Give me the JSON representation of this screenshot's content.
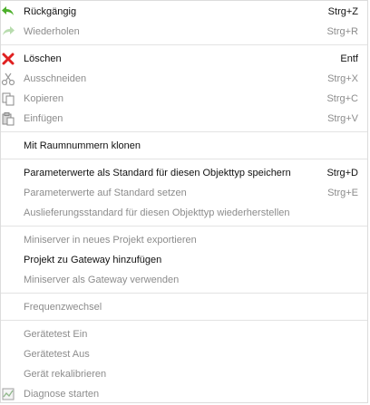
{
  "menu": {
    "items": [
      {
        "label": "Rückgängig",
        "shortcut": "Strg+Z",
        "icon": "undo-arrow-icon",
        "enabled": true
      },
      {
        "label": "Wiederholen",
        "shortcut": "Strg+R",
        "icon": "redo-arrow-icon",
        "enabled": false
      },
      {
        "label": "Löschen",
        "shortcut": "Entf",
        "icon": "delete-x-icon",
        "enabled": true
      },
      {
        "label": "Ausschneiden",
        "shortcut": "Strg+X",
        "icon": "scissors-icon",
        "enabled": false
      },
      {
        "label": "Kopieren",
        "shortcut": "Strg+C",
        "icon": "copy-icon",
        "enabled": false
      },
      {
        "label": "Einfügen",
        "shortcut": "Strg+V",
        "icon": "paste-icon",
        "enabled": false
      },
      {
        "label": "Mit Raumnummern klonen",
        "shortcut": "",
        "enabled": true
      },
      {
        "label": "Parameterwerte als Standard für diesen Objekttyp speichern",
        "shortcut": "Strg+D",
        "enabled": true
      },
      {
        "label": "Parameterwerte auf Standard setzen",
        "shortcut": "Strg+E",
        "enabled": false
      },
      {
        "label": "Auslieferungsstandard für diesen Objekttyp wiederherstellen",
        "shortcut": "",
        "enabled": false
      },
      {
        "label": "Miniserver in neues Projekt exportieren",
        "shortcut": "",
        "enabled": false
      },
      {
        "label": "Projekt zu Gateway hinzufügen",
        "shortcut": "",
        "enabled": true
      },
      {
        "label": "Miniserver als Gateway verwenden",
        "shortcut": "",
        "enabled": false
      },
      {
        "label": "Frequenzwechsel",
        "shortcut": "",
        "enabled": false
      },
      {
        "label": "Gerätetest Ein",
        "shortcut": "",
        "enabled": false
      },
      {
        "label": "Gerätetest Aus",
        "shortcut": "",
        "enabled": false
      },
      {
        "label": "Gerät rekalibrieren",
        "shortcut": "",
        "enabled": false
      },
      {
        "label": "Diagnose starten",
        "shortcut": "",
        "icon": "diagnosis-chart-icon",
        "enabled": false
      }
    ]
  },
  "colors": {
    "undo_green": "#4caf2a",
    "delete_red": "#e02020",
    "disabled_text": "#8c8c8c",
    "separator": "#e3e3e3"
  }
}
